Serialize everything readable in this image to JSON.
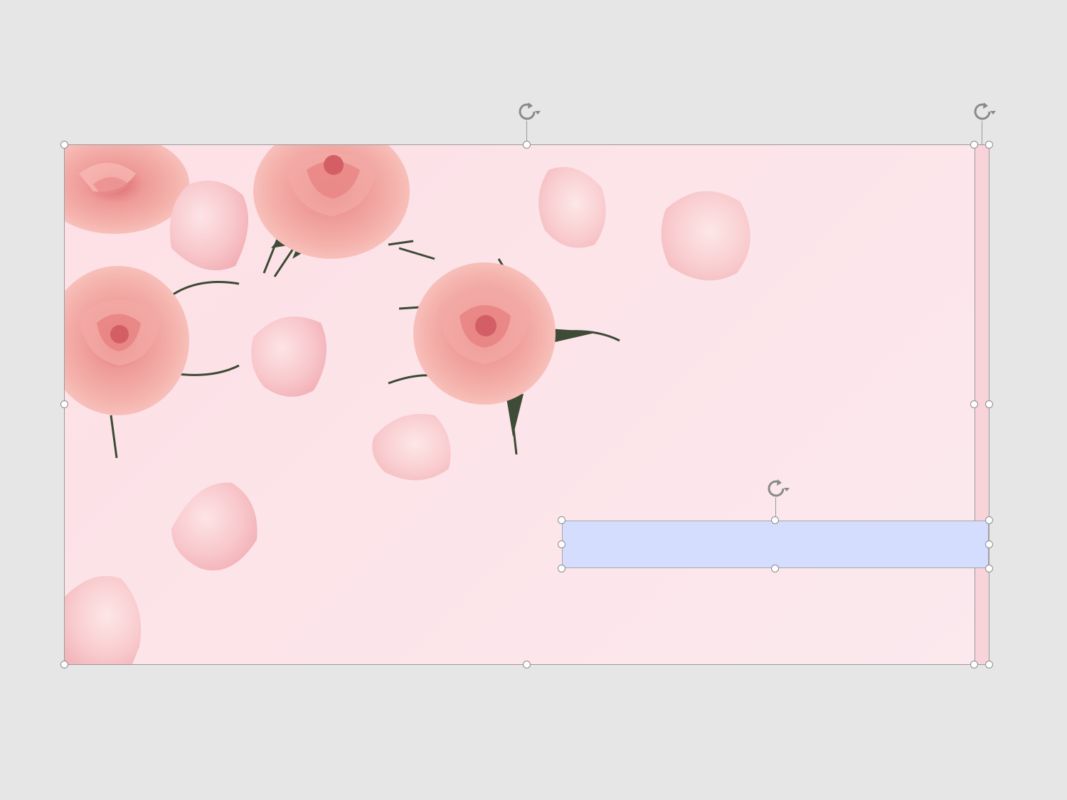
{
  "slide": {
    "background_color": "#fce4e9",
    "picture_description_icon": "rose-petal-photo",
    "strip_color": "#f8d3da"
  },
  "text_box": {
    "text": "",
    "fill_color": "#d4ddfe"
  },
  "selection": {
    "handle_color": "#ffffff",
    "handle_border_color": "#8c8c8c",
    "rotate_icon": "rotate-icon"
  }
}
